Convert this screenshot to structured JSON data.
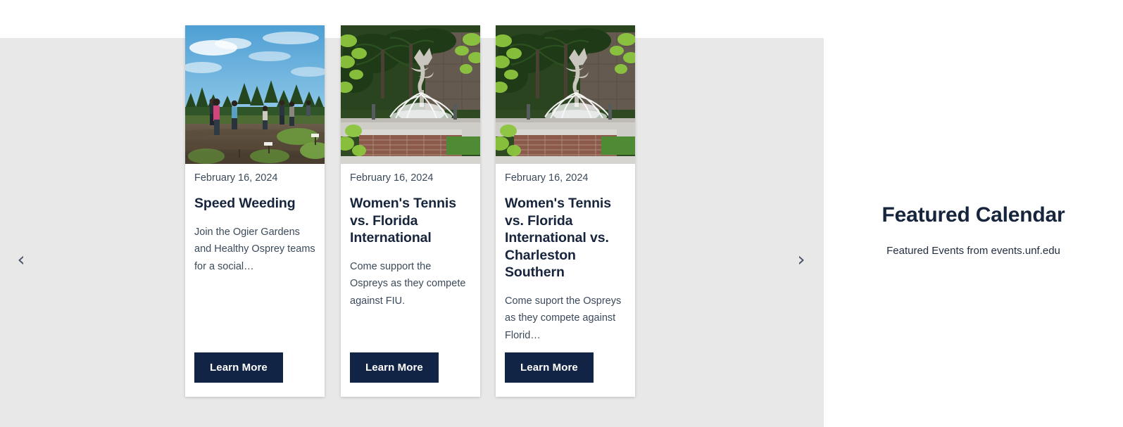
{
  "colors": {
    "panel_background": "#e8e8e8",
    "page_background": "#ffffff",
    "card_background": "#ffffff",
    "button_background": "#112445",
    "button_text": "#ffffff",
    "title_text": "#16243c",
    "body_text": "#3b4a5a",
    "arrow": "#4a5568"
  },
  "carousel": {
    "prev_label": "‹",
    "next_label": "›",
    "prev_icon_name": "chevron-left-icon",
    "next_icon_name": "chevron-right-icon",
    "cards": [
      {
        "date": "February 16, 2024",
        "title": "Speed Weeding",
        "description": "Join the Ogier Gardens and Healthy Osprey teams for a social…",
        "button_label": "Learn More",
        "image_name": "community-garden-photo",
        "image_alt": "Volunteers working rows in a community garden under a blue sky with pine trees"
      },
      {
        "date": "February 16, 2024",
        "title": "Women's Tennis vs. Florida International",
        "description": "Come support the Ospreys as they compete against FIU.",
        "button_label": "Learn More",
        "image_name": "campus-fountain-photo",
        "image_alt": "Campus osprey sculpture fountain with brick base framed by palm and green leaves"
      },
      {
        "date": "February 16, 2024",
        "title": "Women's Tennis vs. Florida International vs. Charleston Southern",
        "description": "Come suport the Ospreys as they compete against Florid…",
        "button_label": "Learn More",
        "image_name": "campus-fountain-photo",
        "image_alt": "Campus osprey sculpture fountain with brick base framed by palm and green leaves"
      }
    ]
  },
  "feature": {
    "title": "Featured Calendar",
    "subtitle": "Featured Events from events.unf.edu"
  }
}
